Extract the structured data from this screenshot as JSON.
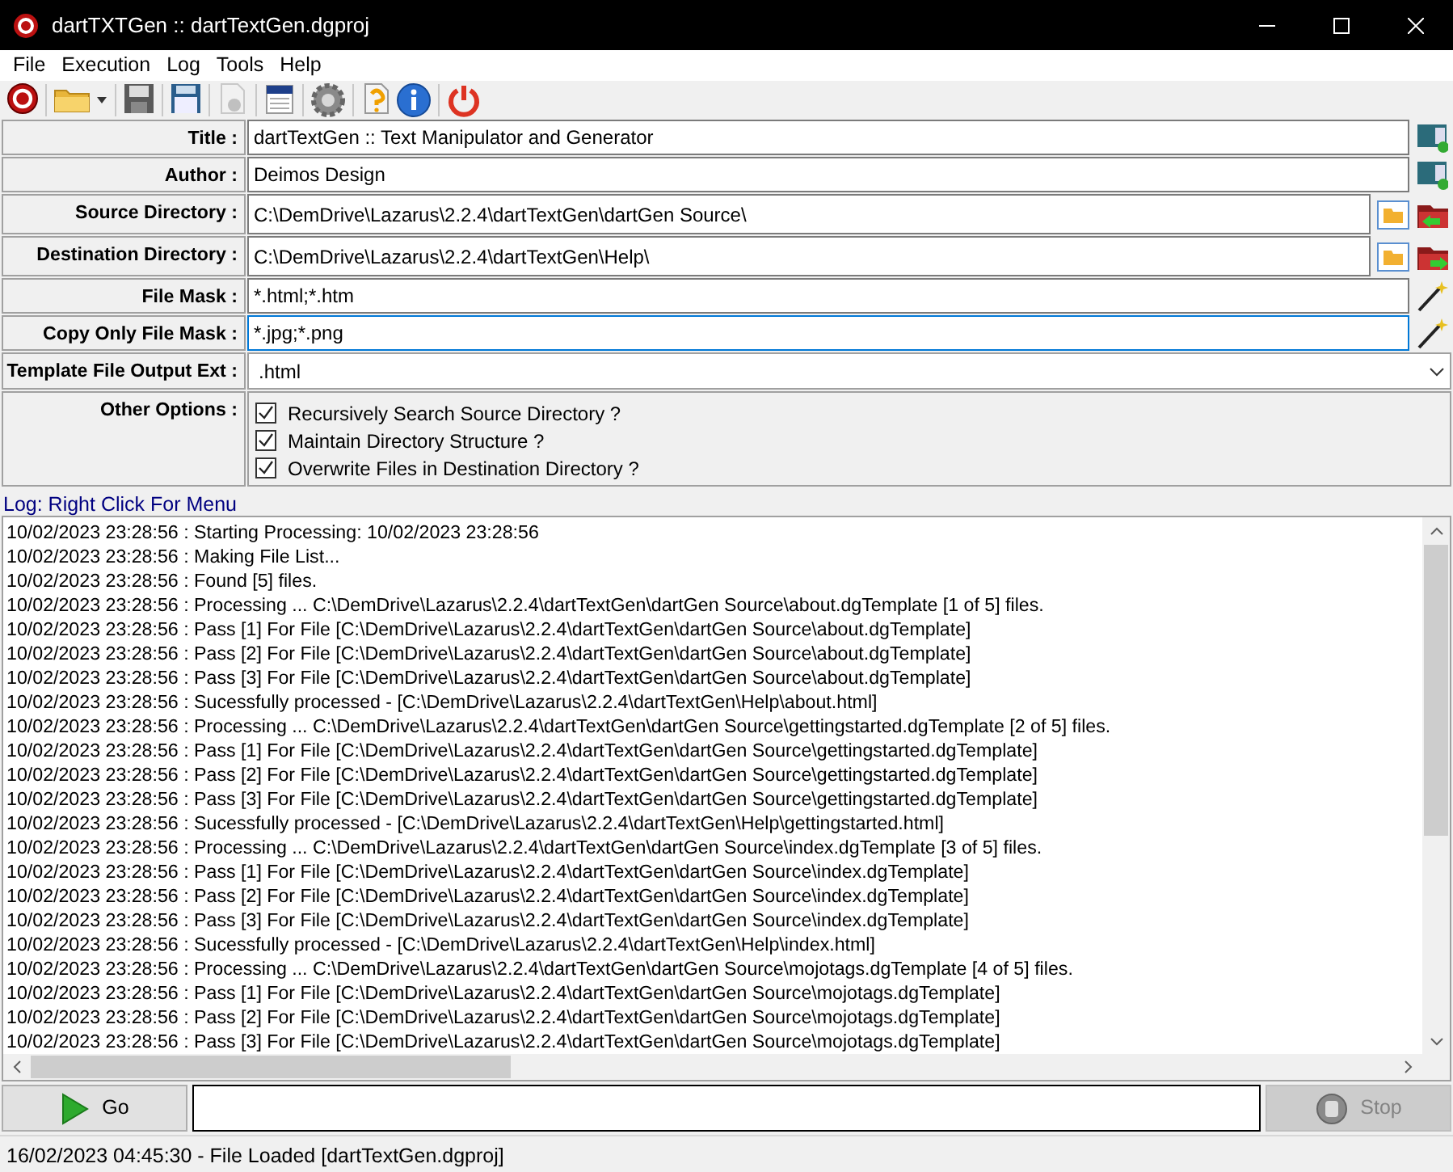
{
  "window": {
    "title": "dartTXTGen :: dartTextGen.dgproj"
  },
  "menu": [
    "File",
    "Execution",
    "Log",
    "Tools",
    "Help"
  ],
  "toolbar": [
    {
      "disabled": false
    },
    {
      "disabled": false
    },
    {
      "disabled": false
    },
    {
      "disabled": false
    },
    {
      "disabled": true
    },
    {
      "disabled": false
    },
    {
      "disabled": false
    },
    {
      "disabled": false
    },
    {
      "disabled": false
    },
    {
      "disabled": false
    }
  ],
  "fields": [
    {
      "kind": "text",
      "label": "Title :",
      "value": "dartTextGen :: Text Manipulator and Generator",
      "focused": false
    },
    {
      "kind": "text",
      "label": "Author :",
      "value": "Deimos Design",
      "focused": false
    },
    {
      "kind": "directory",
      "label": "Source Directory :",
      "value": "C:\\DemDrive\\Lazarus\\2.2.4\\dartTextGen\\dartGen Source\\",
      "focused": false
    },
    {
      "kind": "directory",
      "label": "Destination Directory :",
      "value": "C:\\DemDrive\\Lazarus\\2.2.4\\dartTextGen\\Help\\",
      "focused": false
    },
    {
      "kind": "mask",
      "label": "File Mask :",
      "value": "*.html;*.htm",
      "focused": false
    },
    {
      "kind": "mask",
      "label": "Copy Only File Mask :",
      "value": "*.jpg;*.png",
      "focused": true
    },
    {
      "kind": "select",
      "label": "Template File Output Ext :",
      "value": ".html"
    },
    {
      "kind": "options",
      "label": "Other Options :",
      "options": [
        {
          "label": "Recursively Search Source Directory ?",
          "checked": true
        },
        {
          "label": "Maintain Directory Structure ?",
          "checked": true
        },
        {
          "label": "Overwrite Files in Destination Directory ?",
          "checked": true
        }
      ]
    }
  ],
  "log": {
    "label": "Log: Right Click For Menu",
    "lines": [
      "10/02/2023 23:28:56 : Starting Processing: 10/02/2023 23:28:56",
      "10/02/2023 23:28:56 : Making File List...",
      "10/02/2023 23:28:56 : Found [5] files.",
      "10/02/2023 23:28:56 : Processing ... C:\\DemDrive\\Lazarus\\2.2.4\\dartTextGen\\dartGen Source\\about.dgTemplate [1 of 5] files.",
      "10/02/2023 23:28:56 : Pass [1] For File [C:\\DemDrive\\Lazarus\\2.2.4\\dartTextGen\\dartGen Source\\about.dgTemplate]",
      "10/02/2023 23:28:56 : Pass [2] For File [C:\\DemDrive\\Lazarus\\2.2.4\\dartTextGen\\dartGen Source\\about.dgTemplate]",
      "10/02/2023 23:28:56 : Pass [3] For File [C:\\DemDrive\\Lazarus\\2.2.4\\dartTextGen\\dartGen Source\\about.dgTemplate]",
      "10/02/2023 23:28:56 : Sucessfully processed - [C:\\DemDrive\\Lazarus\\2.2.4\\dartTextGen\\Help\\about.html]",
      "10/02/2023 23:28:56 : Processing ... C:\\DemDrive\\Lazarus\\2.2.4\\dartTextGen\\dartGen Source\\gettingstarted.dgTemplate [2 of 5] files.",
      "10/02/2023 23:28:56 : Pass [1] For File [C:\\DemDrive\\Lazarus\\2.2.4\\dartTextGen\\dartGen Source\\gettingstarted.dgTemplate]",
      "10/02/2023 23:28:56 : Pass [2] For File [C:\\DemDrive\\Lazarus\\2.2.4\\dartTextGen\\dartGen Source\\gettingstarted.dgTemplate]",
      "10/02/2023 23:28:56 : Pass [3] For File [C:\\DemDrive\\Lazarus\\2.2.4\\dartTextGen\\dartGen Source\\gettingstarted.dgTemplate]",
      "10/02/2023 23:28:56 : Sucessfully processed - [C:\\DemDrive\\Lazarus\\2.2.4\\dartTextGen\\Help\\gettingstarted.html]",
      "10/02/2023 23:28:56 : Processing ... C:\\DemDrive\\Lazarus\\2.2.4\\dartTextGen\\dartGen Source\\index.dgTemplate [3 of 5] files.",
      "10/02/2023 23:28:56 : Pass [1] For File [C:\\DemDrive\\Lazarus\\2.2.4\\dartTextGen\\dartGen Source\\index.dgTemplate]",
      "10/02/2023 23:28:56 : Pass [2] For File [C:\\DemDrive\\Lazarus\\2.2.4\\dartTextGen\\dartGen Source\\index.dgTemplate]",
      "10/02/2023 23:28:56 : Pass [3] For File [C:\\DemDrive\\Lazarus\\2.2.4\\dartTextGen\\dartGen Source\\index.dgTemplate]",
      "10/02/2023 23:28:56 : Sucessfully processed - [C:\\DemDrive\\Lazarus\\2.2.4\\dartTextGen\\Help\\index.html]",
      "10/02/2023 23:28:56 : Processing ... C:\\DemDrive\\Lazarus\\2.2.4\\dartTextGen\\dartGen Source\\mojotags.dgTemplate [4 of 5] files.",
      "10/02/2023 23:28:56 : Pass [1] For File [C:\\DemDrive\\Lazarus\\2.2.4\\dartTextGen\\dartGen Source\\mojotags.dgTemplate]",
      "10/02/2023 23:28:56 : Pass [2] For File [C:\\DemDrive\\Lazarus\\2.2.4\\dartTextGen\\dartGen Source\\mojotags.dgTemplate]",
      "10/02/2023 23:28:56 : Pass [3] For File [C:\\DemDrive\\Lazarus\\2.2.4\\dartTextGen\\dartGen Source\\mojotags.dgTemplate]"
    ]
  },
  "actions": [
    {
      "kind": "go",
      "label": "Go",
      "disabled": false
    },
    {
      "kind": "stop",
      "label": "Stop",
      "disabled": true
    }
  ],
  "status_bar": "16/02/2023 04:45:30 - File Loaded [dartTextGen.dgproj]"
}
